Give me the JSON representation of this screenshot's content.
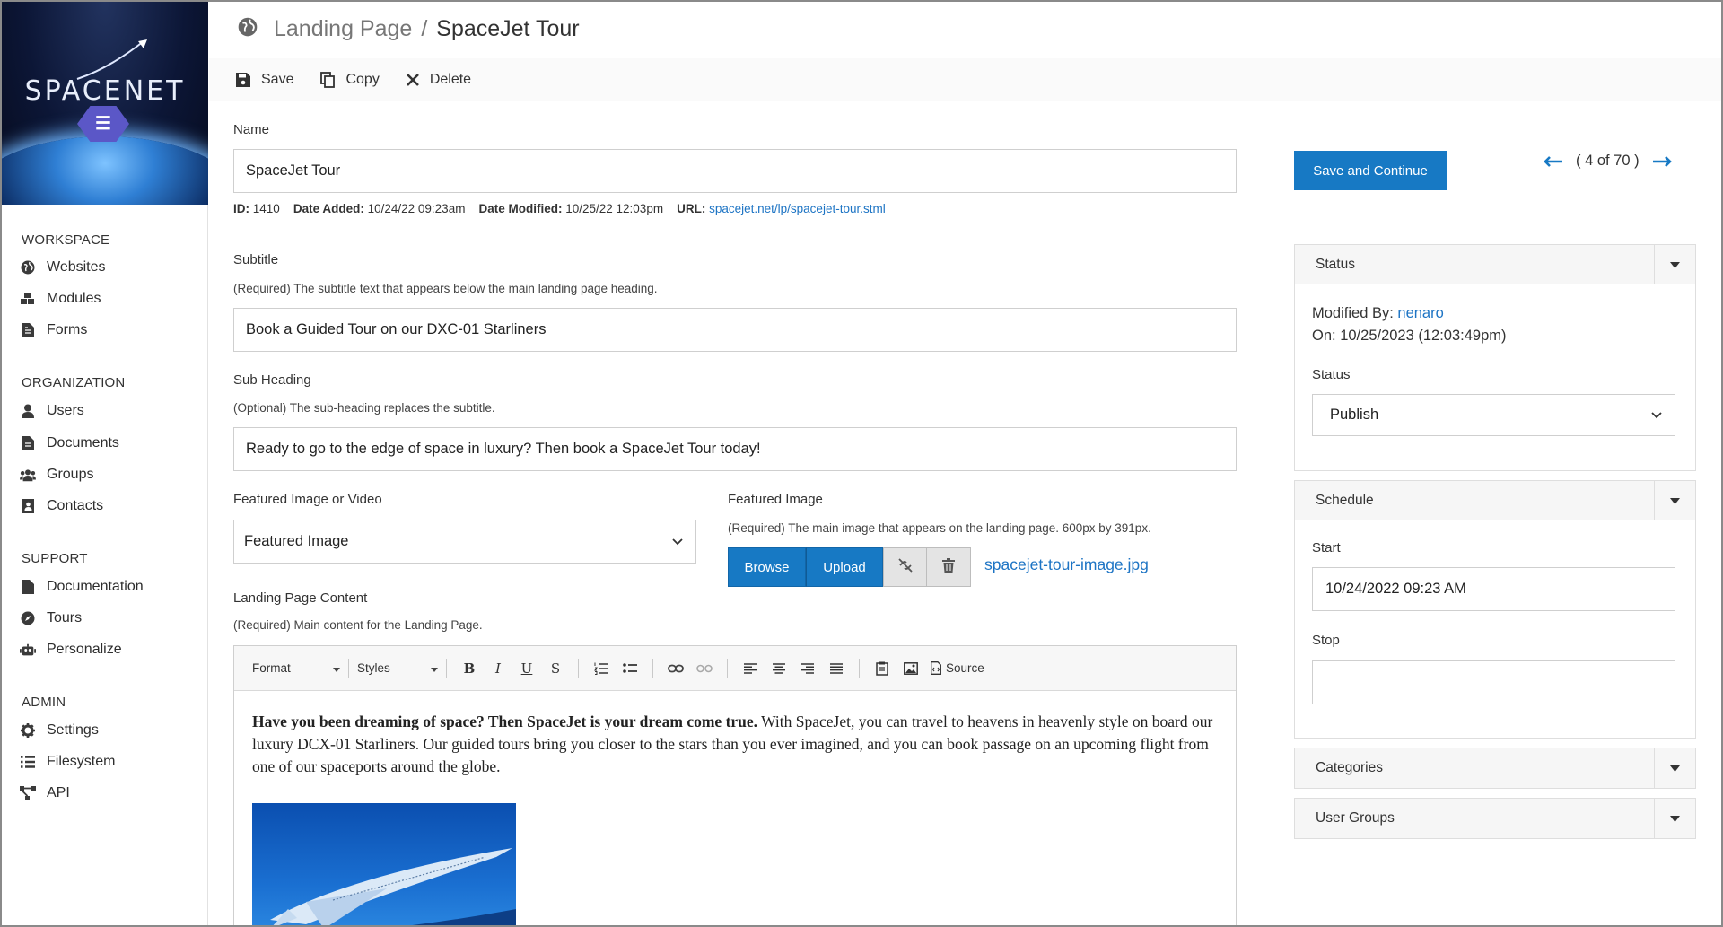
{
  "sidebar": {
    "brand": "SPACENET",
    "sections": [
      {
        "title": "WORKSPACE",
        "items": [
          {
            "label": "Websites",
            "icon": "globe-icon"
          },
          {
            "label": "Modules",
            "icon": "cubes-icon"
          },
          {
            "label": "Forms",
            "icon": "file-form-icon"
          }
        ]
      },
      {
        "title": "ORGANIZATION",
        "items": [
          {
            "label": "Users",
            "icon": "user-icon"
          },
          {
            "label": "Documents",
            "icon": "document-icon"
          },
          {
            "label": "Groups",
            "icon": "users-icon"
          },
          {
            "label": "Contacts",
            "icon": "contact-book-icon"
          }
        ]
      },
      {
        "title": "SUPPORT",
        "items": [
          {
            "label": "Documentation",
            "icon": "document-icon"
          },
          {
            "label": "Tours",
            "icon": "compass-icon"
          },
          {
            "label": "Personalize",
            "icon": "robot-icon"
          }
        ]
      },
      {
        "title": "ADMIN",
        "items": [
          {
            "label": "Settings",
            "icon": "gear-icon"
          },
          {
            "label": "Filesystem",
            "icon": "list-icon"
          },
          {
            "label": "API",
            "icon": "network-icon"
          }
        ]
      }
    ]
  },
  "header": {
    "breadcrumb_parent": "Landing Page",
    "separator": "/",
    "title": "SpaceJet Tour"
  },
  "toolbar": {
    "save_label": "Save",
    "copy_label": "Copy",
    "delete_label": "Delete"
  },
  "form": {
    "name_label": "Name",
    "name_value": "SpaceJet Tour",
    "meta": {
      "id_label": "ID:",
      "id_value": "1410",
      "added_label": "Date Added:",
      "added_value": "10/24/22 09:23am",
      "modified_label": "Date Modified:",
      "modified_value": "10/25/22 12:03pm",
      "url_label": "URL:",
      "url_value": "spacejet.net/lp/spacejet-tour.stml"
    },
    "subtitle_label": "Subtitle",
    "subtitle_help": "(Required) The subtitle text that appears below the main landing page heading.",
    "subtitle_value": "Book a Guided Tour on our DXC-01 Starliners",
    "subheading_label": "Sub Heading",
    "subheading_help": "(Optional) The sub-heading replaces the subtitle.",
    "subheading_value": "Ready to go to the edge of space in luxury? Then book a SpaceJet Tour today!",
    "featured_type_label": "Featured Image or Video",
    "featured_type_value": "Featured Image",
    "featured_image_label": "Featured Image",
    "featured_image_help": "(Required) The main image that appears on the landing page. 600px by 391px.",
    "browse_label": "Browse",
    "upload_label": "Upload",
    "featured_image_file": "spacejet-tour-image.jpg",
    "content_label": "Landing Page Content",
    "content_help": "(Required) Main content for the Landing Page."
  },
  "editor": {
    "format_label": "Format",
    "styles_label": "Styles",
    "source_label": "Source",
    "content_bold": "Have you been dreaming of space? Then SpaceJet is your dream come true.",
    "content_rest": " With SpaceJet, you can travel to heavens in heavenly style on board our luxury DCX-01 Starliners. Our guided tours bring you closer to the stars than you ever imagined, and you can book passage on an upcoming flight from one of our spaceports around the globe."
  },
  "right": {
    "save_continue_label": "Save and Continue",
    "pager_text": "( 4 of 70 )",
    "status_panel": {
      "title": "Status",
      "modified_by_label": "Modified By:",
      "modified_by_user": "nenaro",
      "on_label": "On:",
      "on_value": "10/25/2023 (12:03:49pm)",
      "status_label": "Status",
      "status_value": "Publish"
    },
    "schedule_panel": {
      "title": "Schedule",
      "start_label": "Start",
      "start_value": "10/24/2022 09:23 AM",
      "stop_label": "Stop",
      "stop_value": ""
    },
    "categories_title": "Categories",
    "user_groups_title": "User Groups"
  },
  "colors": {
    "accent": "#1779c4",
    "link": "#1d74c4"
  }
}
